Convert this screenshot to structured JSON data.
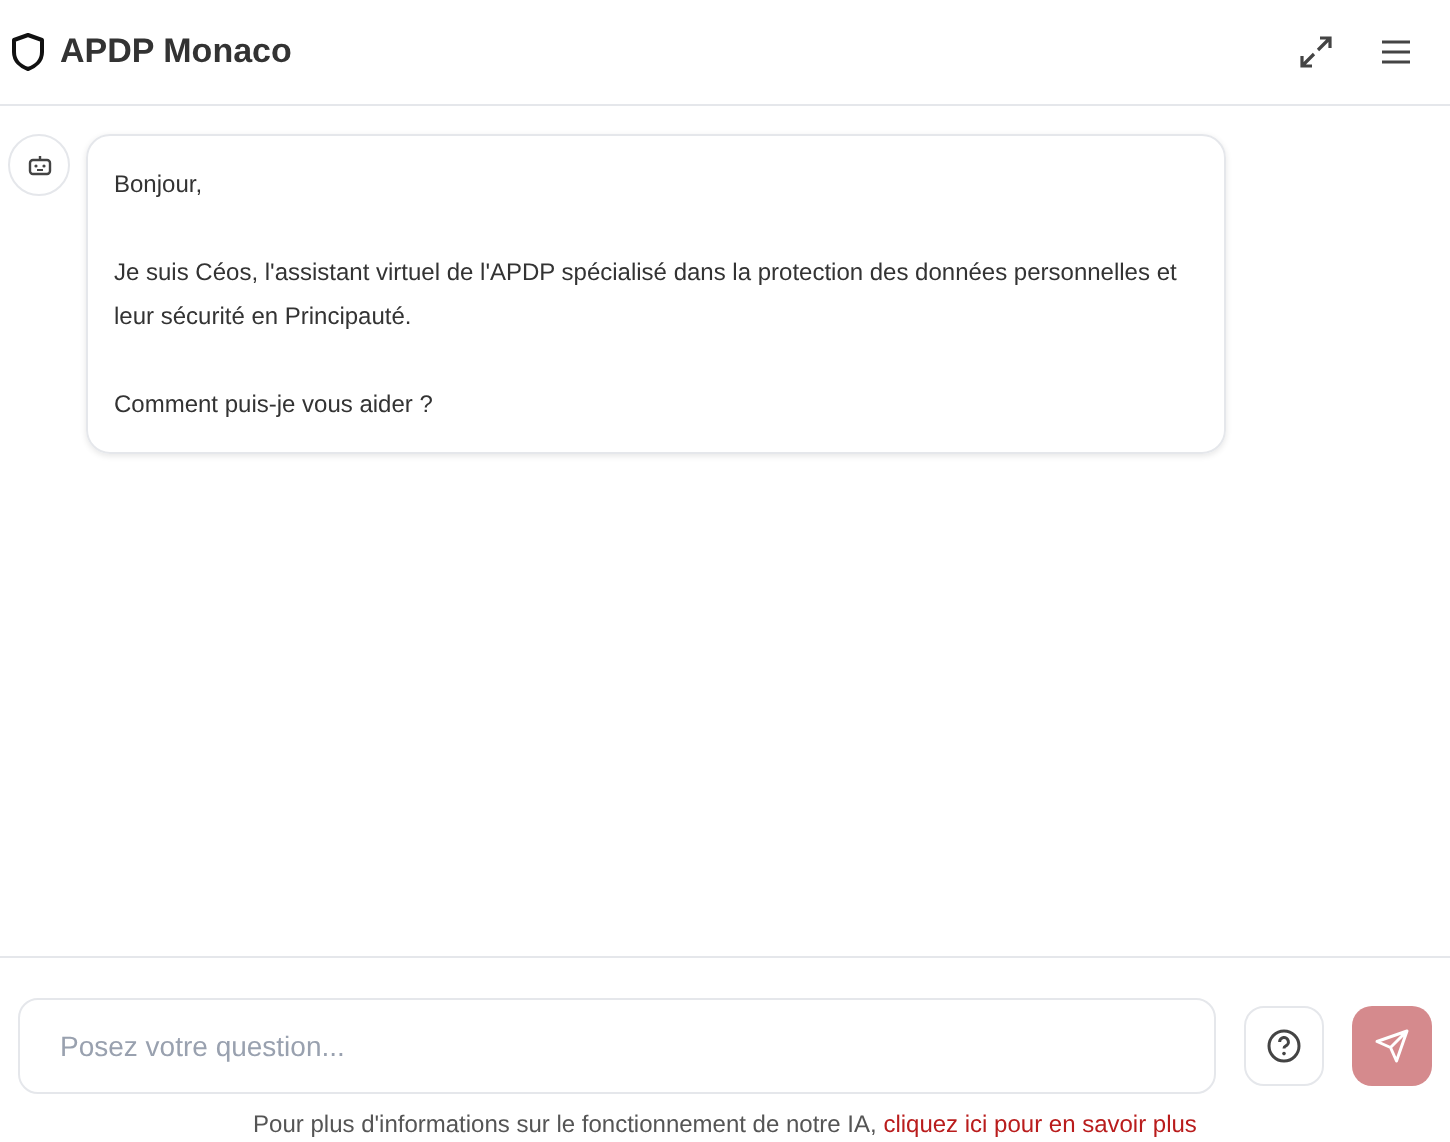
{
  "header": {
    "title": "APDP Monaco"
  },
  "messages": [
    {
      "kind": "bot",
      "paragraphs": [
        "Bonjour,",
        "Je suis Céos, l'assistant virtuel de l'APDP spécialisé dans la protection des données personnelles et leur sécurité en Principauté.",
        "Comment puis-je vous aider ?"
      ]
    }
  ],
  "composer": {
    "placeholder": "Posez votre question...",
    "send_disabled": true
  },
  "footer": {
    "text": "Pour plus d'informations sur le fonctionnement de notre IA,",
    "link": "cliquez ici pour en savoir plus"
  }
}
